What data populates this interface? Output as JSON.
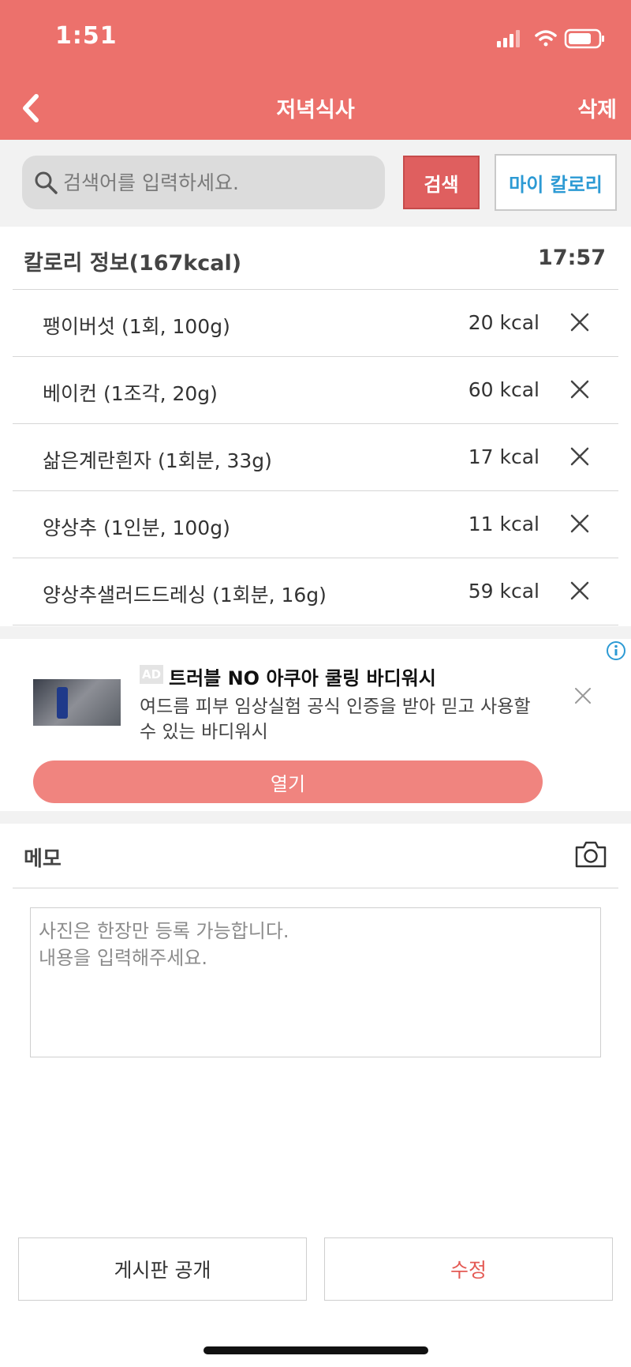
{
  "status": {
    "time": "1:51"
  },
  "nav": {
    "title": "저녁식사",
    "delete_label": "삭제"
  },
  "search": {
    "placeholder": "검색어를 입력하세요.",
    "button_label": "검색",
    "my_calorie_label": "마이 칼로리"
  },
  "calorie_info": {
    "title": "칼로리 정보(167kcal)",
    "time": "17:57"
  },
  "foods": [
    {
      "name": "팽이버섯 (1회, 100g)",
      "kcal": "20 kcal"
    },
    {
      "name": "베이컨 (1조각, 20g)",
      "kcal": "60 kcal"
    },
    {
      "name": "삶은계란흰자 (1회분, 33g)",
      "kcal": "17 kcal"
    },
    {
      "name": "양상추 (1인분, 100g)",
      "kcal": "11 kcal"
    },
    {
      "name": "양상추샐러드드레싱 (1회분, 16g)",
      "kcal": "59 kcal"
    }
  ],
  "ad": {
    "badge": "AD",
    "title": "트러블 NO 아쿠아 쿨링 바디워시",
    "description": "여드름 피부 임상실험 공식 인증을 받아 믿고 사용할 수 있는 바디워시",
    "open_label": "열기"
  },
  "memo": {
    "title": "메모",
    "placeholder": "사진은 한장만 등록 가능합니다.\n내용을 입력해주세요."
  },
  "actions": {
    "public_label": "게시판 공개",
    "edit_label": "수정"
  },
  "colors": {
    "header": "#ec716c",
    "search_button": "#df5f5f",
    "my_calorie_text": "#2c9ad4",
    "ad_button": "#f0847f",
    "edit_text": "#e45a54"
  }
}
